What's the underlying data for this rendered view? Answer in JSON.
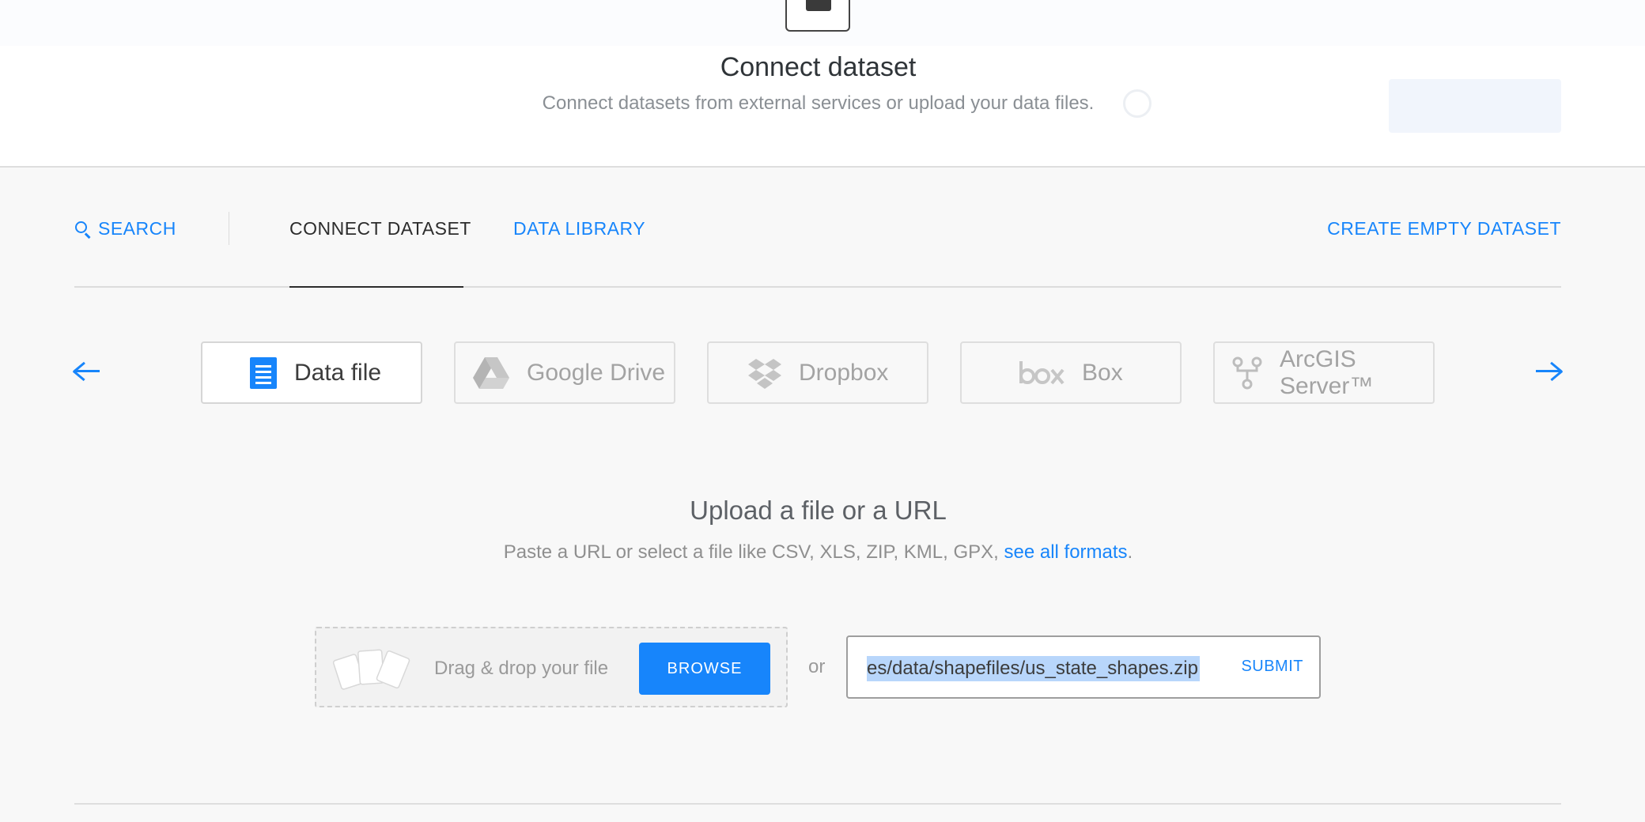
{
  "header": {
    "title": "Connect dataset",
    "subtitle": "Connect datasets from external services or upload your data files."
  },
  "tabs": {
    "search": "SEARCH",
    "connect": "CONNECT DATASET",
    "library": "DATA LIBRARY",
    "create": "CREATE EMPTY DATASET"
  },
  "services": [
    {
      "label": "Data file",
      "icon": "document-icon",
      "active": true
    },
    {
      "label": "Google Drive",
      "icon": "google-drive-icon",
      "active": false
    },
    {
      "label": "Dropbox",
      "icon": "dropbox-icon",
      "active": false
    },
    {
      "label": "Box",
      "icon": "box-icon",
      "active": false
    },
    {
      "label": "ArcGIS Server™",
      "icon": "arcgis-icon",
      "active": false
    }
  ],
  "upload": {
    "title": "Upload a file or a URL",
    "subtitle_prefix": "Paste a URL or select a file like CSV, XLS, ZIP, KML, GPX, ",
    "subtitle_link": "see all formats",
    "subtitle_suffix": ".",
    "drop_text": "Drag & drop your file",
    "browse_label": "BROWSE",
    "or_label": "or",
    "url_value": "es/data/shapefiles/us_state_shapes.zip",
    "submit_label": "SUBMIT"
  },
  "colors": {
    "accent": "#1785fb",
    "background": "#f8f8f8",
    "selection": "#b8d6fb"
  }
}
